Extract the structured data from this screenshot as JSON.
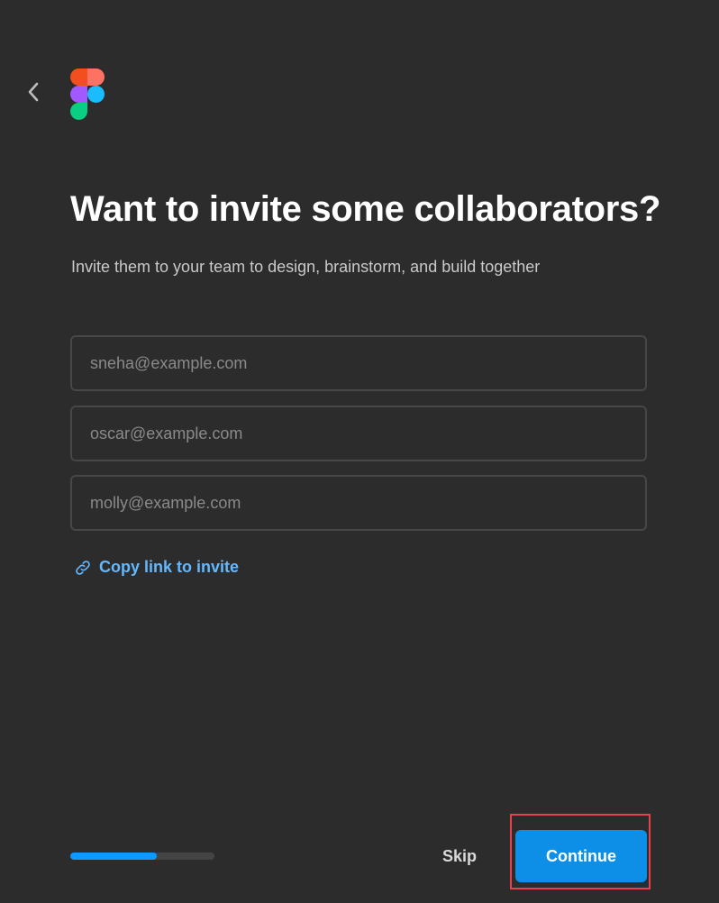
{
  "header": {
    "back_icon": "chevron-left-icon",
    "logo_icon": "figma-logo-icon",
    "logo_colors": [
      "#f24e1e",
      "#ff7262",
      "#a259ff",
      "#1abcfe",
      "#0acf83"
    ]
  },
  "main": {
    "title": "Want to invite some collaborators?",
    "subtitle": "Invite them to your team to design, brainstorm, and build together",
    "inputs": [
      {
        "value": "",
        "placeholder": "sneha@example.com"
      },
      {
        "value": "",
        "placeholder": "oscar@example.com"
      },
      {
        "value": "",
        "placeholder": "molly@example.com"
      }
    ],
    "copy_link": {
      "icon": "link-icon",
      "label": "Copy link to invite",
      "color": "#64b8ff"
    }
  },
  "footer": {
    "progress": 0.6,
    "progress_color": "#0d99ff",
    "skip_label": "Skip",
    "continue_label": "Continue",
    "continue_color": "#0d8fe8",
    "highlight_color": "#e8414f"
  }
}
